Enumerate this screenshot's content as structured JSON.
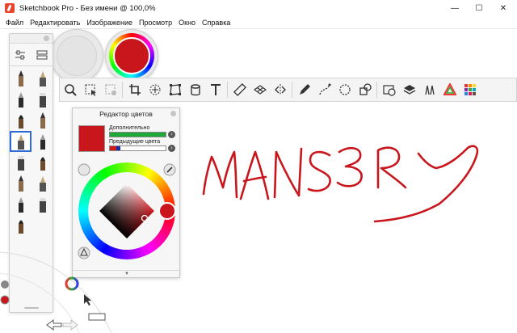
{
  "window": {
    "title": "Sketchbook Pro - Без имени @ 100,0%",
    "minimize_glyph": "—",
    "maximize_glyph": "☐",
    "close_glyph": "✕"
  },
  "menu": {
    "items": [
      "Файл",
      "Редактировать",
      "Изображение",
      "Просмотр",
      "Окно",
      "Справка"
    ]
  },
  "brush_palette": {
    "tabs": [
      "sliders-icon",
      "brush-library-icon"
    ],
    "brushes": [
      "pencil-icon",
      "ballpoint-pen-icon",
      "fineliner-icon",
      "marker-icon",
      "paintbrush-icon",
      "flat-brush-icon",
      "airbrush-icon",
      "soft-eraser-icon",
      "chisel-marker-icon",
      "felt-pen-icon",
      "ink-pen-icon",
      "smudge-icon",
      "paint-tube-icon",
      "water-brush-icon",
      "texture-brush-icon"
    ],
    "selected_index": 6
  },
  "color_puck": {
    "current_color": "#c8161c"
  },
  "toolbar": {
    "tools": [
      "zoom-icon",
      "select-icon",
      "lasso-select-icon",
      "crop-icon",
      "transform-icon",
      "distort-icon",
      "fill-icon",
      "text-icon",
      "ruler-icon",
      "perspective-icon",
      "symmetry-icon",
      "pen-icon",
      "curve-icon",
      "ellipse-icon",
      "shape-icon",
      "timer-icon",
      "layers-icon",
      "brush-properties-icon",
      "color-wheel-icon",
      "copic-colors-icon"
    ]
  },
  "color_editor": {
    "title": "Редактор цветов",
    "additional_label": "Дополнительно",
    "previous_label": "Предыдущие цвета",
    "current_color": "#c8161c",
    "additional_color": "#1fa83a",
    "previous_colors": [
      "#d11a1a",
      "#1a2aa8"
    ]
  },
  "canvas": {
    "stroke_color": "#c8161c"
  },
  "lagoon": {
    "color_wheel_icon": "color-wheel-icon",
    "undo_icon": "undo-icon",
    "redo_icon": "redo-icon",
    "cursor_icon": "cursor-icon"
  }
}
